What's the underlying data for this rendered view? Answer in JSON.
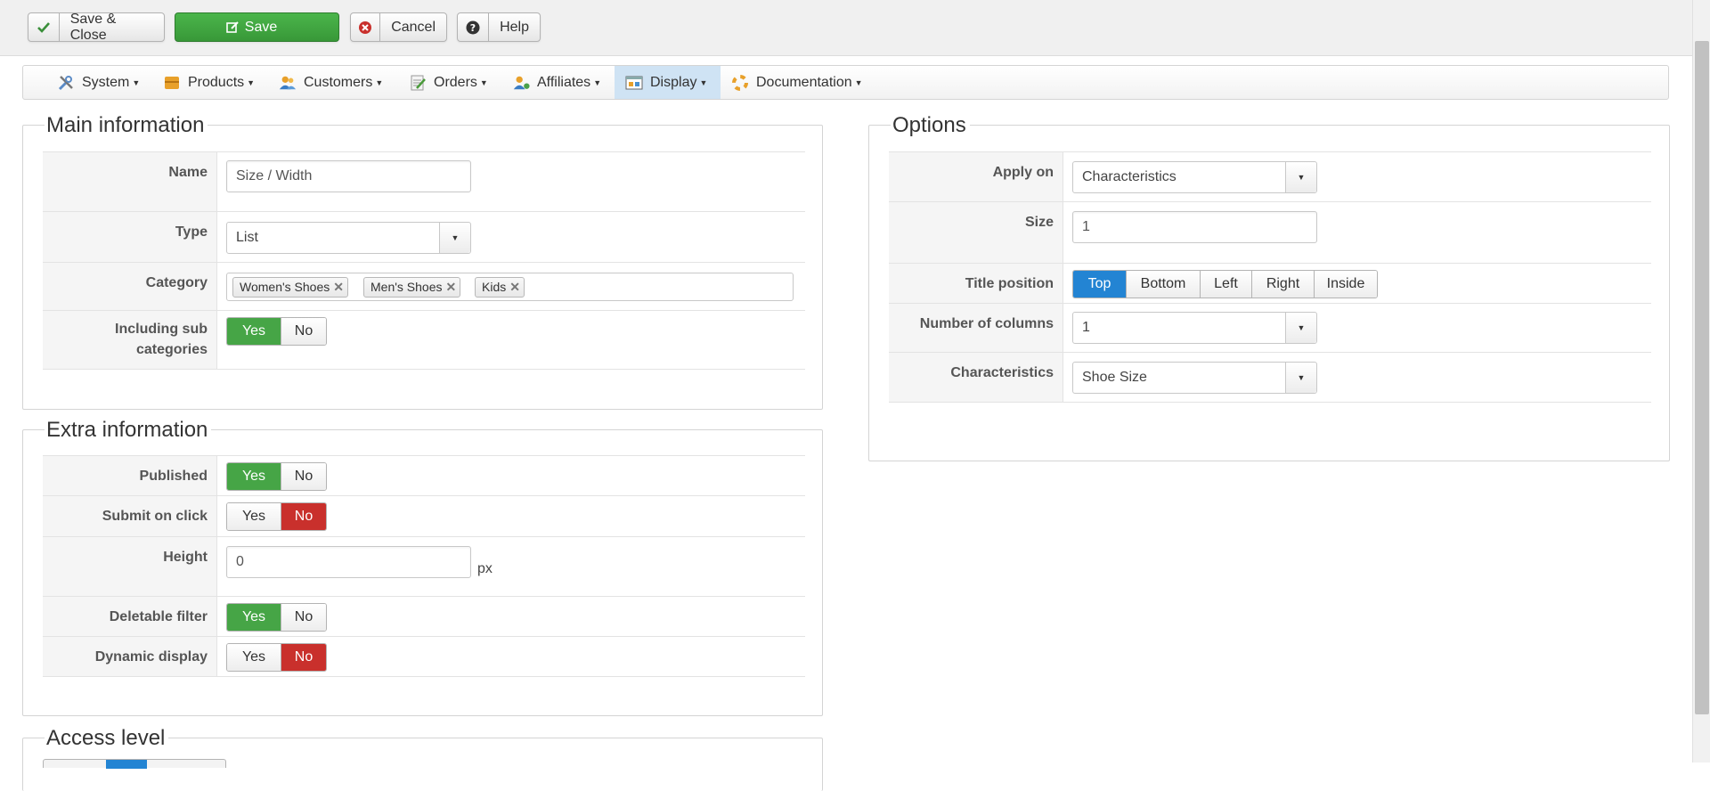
{
  "toolbar": {
    "save_close": "Save & Close",
    "save": "Save",
    "cancel": "Cancel",
    "help": "Help"
  },
  "menu": {
    "items": [
      {
        "label": "System",
        "icon": "tools-icon"
      },
      {
        "label": "Products",
        "icon": "box-icon"
      },
      {
        "label": "Customers",
        "icon": "users-icon"
      },
      {
        "label": "Orders",
        "icon": "orders-icon"
      },
      {
        "label": "Affiliates",
        "icon": "affiliates-icon"
      },
      {
        "label": "Display",
        "icon": "display-icon",
        "active": true
      },
      {
        "label": "Documentation",
        "icon": "help-ring-icon"
      }
    ]
  },
  "main_info": {
    "legend": "Main information",
    "name_label": "Name",
    "name_value": "Size / Width",
    "type_label": "Type",
    "type_value": "List",
    "category_label": "Category",
    "categories": [
      "Women's Shoes",
      "Men's Shoes",
      "Kids"
    ],
    "tag_remove": "✕",
    "sub_label_1": "Including sub",
    "sub_label_2": "categories",
    "sub_value": "Yes"
  },
  "extra_info": {
    "legend": "Extra information",
    "published_label": "Published",
    "published_value": "Yes",
    "submit_label": "Submit on click",
    "submit_value": "No",
    "height_label": "Height",
    "height_value": "0",
    "height_unit": "px",
    "deletable_label": "Deletable filter",
    "deletable_value": "Yes",
    "dynamic_label": "Dynamic display",
    "dynamic_value": "No"
  },
  "options": {
    "legend": "Options",
    "apply_label": "Apply on",
    "apply_value": "Characteristics",
    "size_label": "Size",
    "size_value": "1",
    "title_pos_label": "Title position",
    "title_pos_options": [
      "Top",
      "Bottom",
      "Left",
      "Right",
      "Inside"
    ],
    "title_pos_value": "Top",
    "columns_label": "Number of columns",
    "columns_value": "1",
    "char_label": "Characteristics",
    "char_value": "Shoe Size"
  },
  "access": {
    "legend": "Access level"
  },
  "toggle_labels": {
    "yes": "Yes",
    "no": "No"
  },
  "colors": {
    "save_green": "#46a546",
    "yes_green": "#46a546",
    "no_red": "#c9302c",
    "active_blue": "#2384d3",
    "menu_active_bg": "#cfe3f4"
  }
}
